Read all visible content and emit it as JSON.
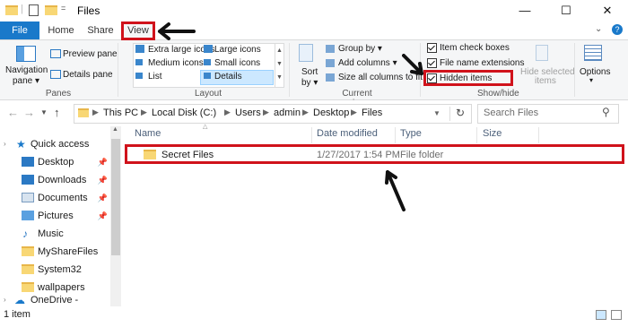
{
  "window": {
    "title": "Files",
    "minimize": "—",
    "maximize": "☐",
    "close": "✕"
  },
  "tabs": [
    "File",
    "Home",
    "Share",
    "View"
  ],
  "ribbon": {
    "panes": {
      "navigation_pane": "Navigation",
      "navigation_pane2": "pane ▾",
      "preview_pane": "Preview pane",
      "details_pane": "Details pane",
      "label": "Panes"
    },
    "layout": {
      "items": [
        "Extra large icons",
        "Large icons",
        "Medium icons",
        "Small icons",
        "List",
        "Details"
      ],
      "label": "Layout",
      "selected": "Details"
    },
    "current_view": {
      "sort": "Sort",
      "sort2": "by ▾",
      "group_by": "Group by ▾",
      "add_columns": "Add columns ▾",
      "size_all": "Size all columns to fit",
      "label": "Current view"
    },
    "show_hide": {
      "item_check_boxes": "Item check boxes",
      "file_name_extensions": "File name extensions",
      "hidden_items": "Hidden items",
      "hide_selected": "Hide selected",
      "hide_selected2": "items",
      "label": "Show/hide",
      "checks": {
        "item_check_boxes": true,
        "file_name_extensions": true,
        "hidden_items": true
      }
    },
    "options": {
      "label": "Options",
      "label2": "▾"
    }
  },
  "address": {
    "crumbs": [
      "This PC",
      "Local Disk (C:)",
      "Users",
      "admin",
      "Desktop",
      "Files"
    ],
    "search_placeholder": "Search Files"
  },
  "nav": {
    "quick_access": "Quick access",
    "items": [
      {
        "label": "Desktop",
        "pinned": true
      },
      {
        "label": "Downloads",
        "pinned": true
      },
      {
        "label": "Documents",
        "pinned": true
      },
      {
        "label": "Pictures",
        "pinned": true
      },
      {
        "label": "Music",
        "pinned": false
      },
      {
        "label": "MyShareFiles",
        "pinned": false
      },
      {
        "label": "System32",
        "pinned": false
      },
      {
        "label": "wallpapers",
        "pinned": false
      }
    ],
    "onedrive": "OneDrive - Family"
  },
  "columns": {
    "name": "Name",
    "date": "Date modified",
    "type": "Type",
    "size": "Size"
  },
  "files": [
    {
      "name": "Secret Files",
      "date": "1/27/2017 1:54 PM",
      "type": "File folder",
      "size": ""
    }
  ],
  "status": {
    "count": "1 item"
  },
  "colors": {
    "accent": "#1979ca",
    "highlight": "#d0121b"
  }
}
